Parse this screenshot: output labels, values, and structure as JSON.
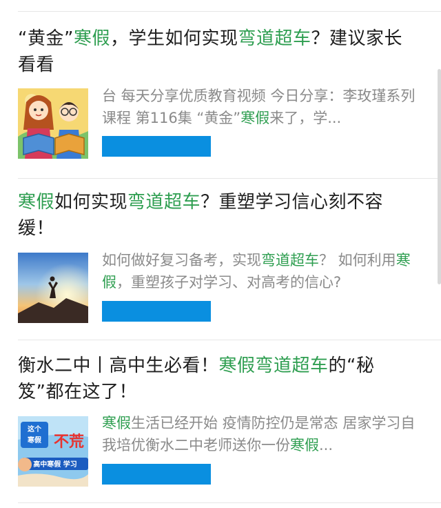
{
  "articles": [
    {
      "title_parts": [
        {
          "text": "“黄金”",
          "hl": false
        },
        {
          "text": "寒假",
          "hl": true
        },
        {
          "text": "，学生如何实现",
          "hl": false
        },
        {
          "text": "弯道超车",
          "hl": true
        },
        {
          "text": "？建议家长看看",
          "hl": false
        }
      ],
      "summary_parts": [
        {
          "text": "台 每天分享优质教育视频 今日分享：李玫瑾系列课程 第116集 “黄金”",
          "hl": false
        },
        {
          "text": "寒假",
          "hl": true
        },
        {
          "text": "来了，学...",
          "hl": false
        }
      ],
      "thumb_icon": "kids-reading-thumbnail"
    },
    {
      "title_parts": [
        {
          "text": "寒假",
          "hl": true
        },
        {
          "text": "如何实现",
          "hl": false
        },
        {
          "text": "弯道超车",
          "hl": true
        },
        {
          "text": "？重塑学习信心刻不容缓！",
          "hl": false
        }
      ],
      "summary_parts": [
        {
          "text": "如何做好复习备考，实现",
          "hl": false
        },
        {
          "text": "弯道超车",
          "hl": true
        },
        {
          "text": "？ 如何利用",
          "hl": false
        },
        {
          "text": "寒假",
          "hl": true
        },
        {
          "text": "，重塑孩子对学习、对高考的信心?",
          "hl": false
        }
      ],
      "thumb_icon": "sunrise-mountain-thumbnail"
    },
    {
      "title_parts": [
        {
          "text": "衡水二中丨高中生必看！",
          "hl": false
        },
        {
          "text": "寒假弯道超车",
          "hl": true
        },
        {
          "text": "的“秘笈”都在这了！",
          "hl": false
        }
      ],
      "summary_parts": [
        {
          "text": "寒假",
          "hl": true
        },
        {
          "text": "生活已经开始 疫情防控仍是常态 居家学习自我培优衡水二中老师送你一份",
          "hl": false
        },
        {
          "text": "寒假",
          "hl": true
        },
        {
          "text": "...",
          "hl": false
        }
      ],
      "thumb_icon": "winter-break-banner-thumbnail",
      "thumb_text": {
        "line1": "这个",
        "line2": "寒假",
        "big": "不荒",
        "banner": "高中寒假 学习"
      }
    }
  ],
  "colors": {
    "highlight": "#2e9e50",
    "title": "#1f1f1f",
    "summary": "#8a8a8a",
    "bar": "#0a8fe0"
  }
}
